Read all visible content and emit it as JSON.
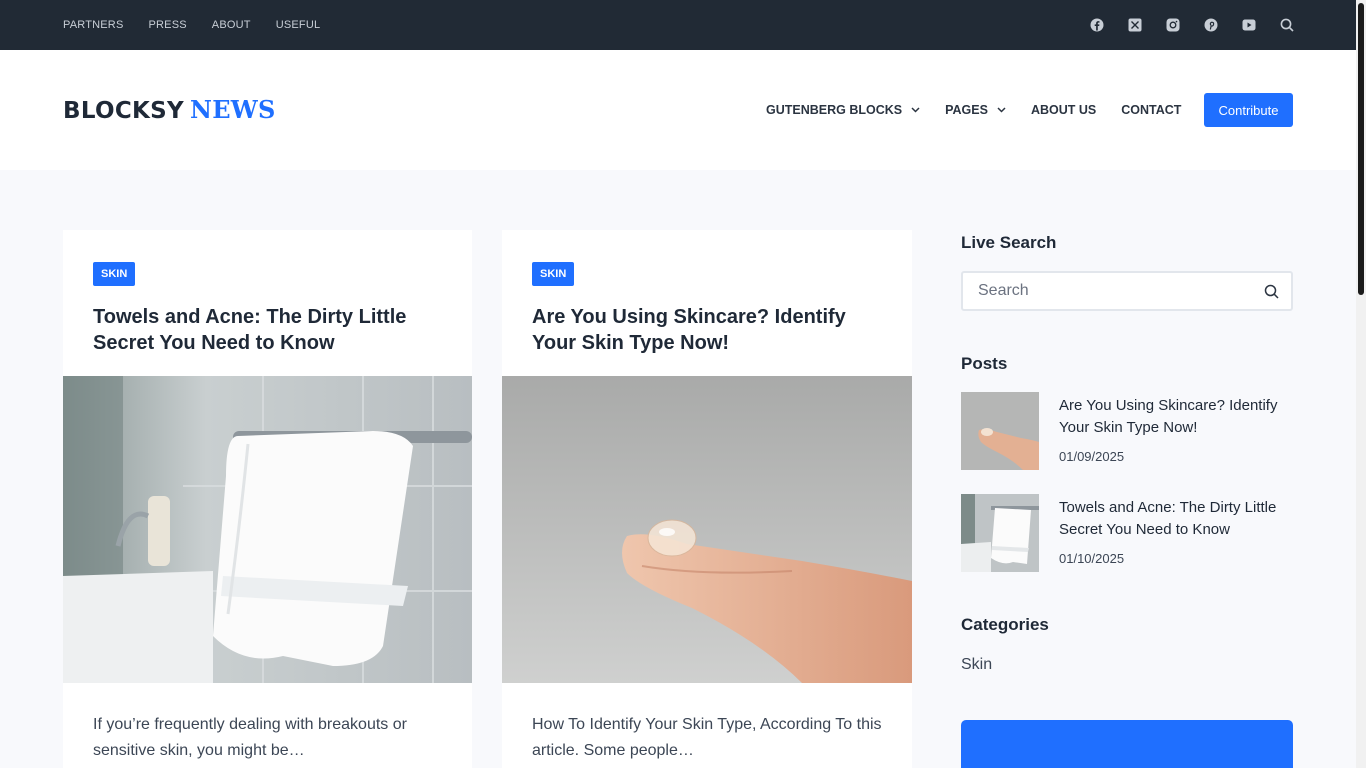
{
  "topbar": {
    "menu": [
      "PARTNERS",
      "PRESS",
      "ABOUT",
      "USEFUL"
    ],
    "social_icons": [
      "facebook-icon",
      "x-icon",
      "instagram-icon",
      "pinterest-icon",
      "youtube-icon",
      "search-icon"
    ]
  },
  "header": {
    "logo_part1": "BLOCKSY",
    "logo_part2": "NEWS",
    "nav": [
      {
        "label": "GUTENBERG BLOCKS",
        "has_dropdown": true
      },
      {
        "label": "PAGES",
        "has_dropdown": true
      },
      {
        "label": "ABOUT US",
        "has_dropdown": false
      },
      {
        "label": "CONTACT",
        "has_dropdown": false
      }
    ],
    "cta_label": "Contribute"
  },
  "posts": [
    {
      "category": "SKIN",
      "title": "Towels and Acne: The Dirty Little Secret You Need to Know",
      "excerpt": "If you’re frequently dealing with breakouts or sensitive skin, you might be…"
    },
    {
      "category": "SKIN",
      "title": "Are You Using Skincare? Identify Your Skin Type Now!",
      "excerpt": "How To Identify Your Skin Type, According To this article. Some people…"
    }
  ],
  "sidebar": {
    "search_heading": "Live Search",
    "search_placeholder": "Search",
    "posts_heading": "Posts",
    "recent_posts": [
      {
        "title": "Are You Using Skincare? Identify Your Skin Type Now!",
        "date": "01/09/2025"
      },
      {
        "title": "Towels and Acne: The Dirty Little Secret You Need to Know",
        "date": "01/10/2025"
      }
    ],
    "categories_heading": "Categories",
    "categories": [
      "Skin"
    ]
  },
  "colors": {
    "accent": "#1f6fff",
    "topbar_bg": "#212a35",
    "page_bg": "#f8f9fc"
  }
}
